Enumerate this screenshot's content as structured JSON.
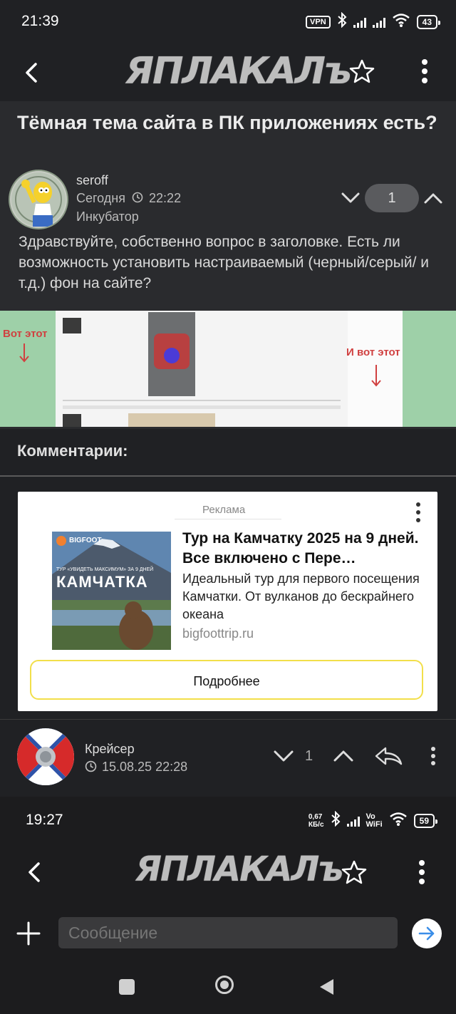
{
  "status_top": {
    "time": "21:39",
    "vpn": "VPN",
    "battery": "43"
  },
  "appbar": {
    "logo": "ЯПЛАКАЛъ"
  },
  "post": {
    "title": "Тёмная тема сайта в ПК приложениях есть?",
    "author": "seroff",
    "date_prefix": "Сегодня",
    "time": "22:22",
    "rank": "Инкубатор",
    "score": "1",
    "body": "Здравствуйте, собственно вопрос в заголовке. Есть ли возможность установить настраиваемый (черный/серый/ и т.д.) фон на сайте?",
    "image_label_left": "Вот этот",
    "image_label_right": "И вот этот"
  },
  "comments_header": "Комментарии:",
  "ad": {
    "label": "Реклама",
    "title": "Тур на Камчатку 2025 на 9 дней. Все включено с Пере…",
    "description": "Идеальный тур для первого посещения Камчатки. От вулканов до бескрайнего океана",
    "url": "bigfoottrip.ru",
    "button": "Подробнее",
    "image_brand": "BIGFOOT",
    "image_tagline": "ТУР «УВИДЕТЬ МАКСИМУМ» ЗА 9 ДНЕЙ",
    "image_title": "КАМЧАТКА"
  },
  "comment": {
    "author": "Крейсер",
    "date": "15.08.25 22:28",
    "score": "1"
  },
  "status_bottom": {
    "time": "19:27",
    "net_speed_value": "0,67",
    "net_speed_unit": "КБ/с",
    "vowifi_1": "Vo",
    "vowifi_2": "WiFi",
    "battery": "59"
  },
  "bottom_appbar": {
    "logo": "ЯПЛАКАЛъ"
  },
  "composer": {
    "placeholder": "Сообщение"
  },
  "colors": {
    "background": "#202124",
    "post_bg": "#2a2b2e",
    "ad_button_border": "#f2df4a",
    "send_button": "#ffffff",
    "send_arrow": "#3b8ee8"
  }
}
